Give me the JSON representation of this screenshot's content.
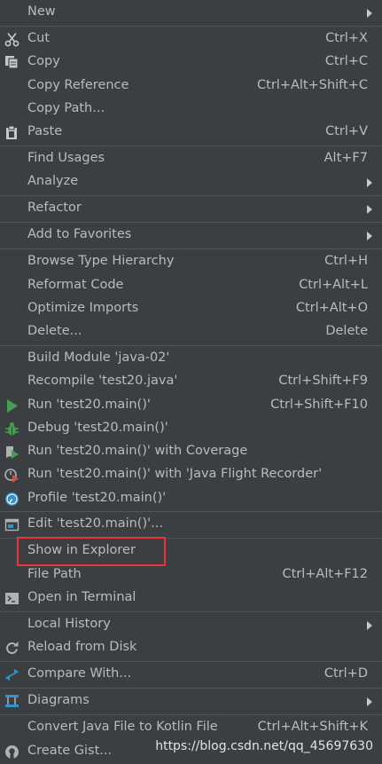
{
  "menu": {
    "items": [
      {
        "label": "New",
        "shortcut": "",
        "submenu": true,
        "icon": ""
      },
      {
        "label": "Cut",
        "shortcut": "Ctrl+X",
        "submenu": false,
        "icon": "scissors-icon"
      },
      {
        "label": "Copy",
        "shortcut": "Ctrl+C",
        "submenu": false,
        "icon": "copy-icon"
      },
      {
        "label": "Copy Reference",
        "shortcut": "Ctrl+Alt+Shift+C",
        "submenu": false,
        "icon": ""
      },
      {
        "label": "Copy Path...",
        "shortcut": "",
        "submenu": false,
        "icon": ""
      },
      {
        "label": "Paste",
        "shortcut": "Ctrl+V",
        "submenu": false,
        "icon": "clipboard-icon"
      },
      {
        "label": "Find Usages",
        "shortcut": "Alt+F7",
        "submenu": false,
        "icon": ""
      },
      {
        "label": "Analyze",
        "shortcut": "",
        "submenu": true,
        "icon": ""
      },
      {
        "label": "Refactor",
        "shortcut": "",
        "submenu": true,
        "icon": ""
      },
      {
        "label": "Add to Favorites",
        "shortcut": "",
        "submenu": true,
        "icon": ""
      },
      {
        "label": "Browse Type Hierarchy",
        "shortcut": "Ctrl+H",
        "submenu": false,
        "icon": ""
      },
      {
        "label": "Reformat Code",
        "shortcut": "Ctrl+Alt+L",
        "submenu": false,
        "icon": ""
      },
      {
        "label": "Optimize Imports",
        "shortcut": "Ctrl+Alt+O",
        "submenu": false,
        "icon": ""
      },
      {
        "label": "Delete...",
        "shortcut": "Delete",
        "submenu": false,
        "icon": ""
      },
      {
        "label": "Build Module 'java-02'",
        "shortcut": "",
        "submenu": false,
        "icon": ""
      },
      {
        "label": "Recompile 'test20.java'",
        "shortcut": "Ctrl+Shift+F9",
        "submenu": false,
        "icon": ""
      },
      {
        "label": "Run 'test20.main()'",
        "shortcut": "Ctrl+Shift+F10",
        "submenu": false,
        "icon": "run-icon"
      },
      {
        "label": "Debug 'test20.main()'",
        "shortcut": "",
        "submenu": false,
        "icon": "debug-icon"
      },
      {
        "label": "Run 'test20.main()' with Coverage",
        "shortcut": "",
        "submenu": false,
        "icon": "coverage-icon"
      },
      {
        "label": "Run 'test20.main()' with 'Java Flight Recorder'",
        "shortcut": "",
        "submenu": false,
        "icon": "flight-recorder-icon"
      },
      {
        "label": "Profile 'test20.main()'",
        "shortcut": "",
        "submenu": false,
        "icon": "profile-icon"
      },
      {
        "label": "Edit 'test20.main()'...",
        "shortcut": "",
        "submenu": false,
        "icon": "edit-config-icon"
      },
      {
        "label": "Show in Explorer",
        "shortcut": "",
        "submenu": false,
        "icon": ""
      },
      {
        "label": "File Path",
        "shortcut": "Ctrl+Alt+F12",
        "submenu": false,
        "icon": ""
      },
      {
        "label": "Open in Terminal",
        "shortcut": "",
        "submenu": false,
        "icon": "terminal-icon"
      },
      {
        "label": "Local History",
        "shortcut": "",
        "submenu": true,
        "icon": ""
      },
      {
        "label": "Reload from Disk",
        "shortcut": "",
        "submenu": false,
        "icon": "reload-icon"
      },
      {
        "label": "Compare With...",
        "shortcut": "Ctrl+D",
        "submenu": false,
        "icon": "compare-icon"
      },
      {
        "label": "Diagrams",
        "shortcut": "",
        "submenu": true,
        "icon": "diagram-icon"
      },
      {
        "label": "Convert Java File to Kotlin File",
        "shortcut": "Ctrl+Alt+Shift+K",
        "submenu": false,
        "icon": ""
      },
      {
        "label": "Create Gist...",
        "shortcut": "",
        "submenu": false,
        "icon": "github-icon"
      }
    ]
  },
  "watermark": "https://blog.csdn.net/qq_45697630",
  "colors": {
    "background": "#3c3f41",
    "text": "#bbbbbb",
    "separator": "#515658",
    "highlight_box": "#e8353a"
  }
}
